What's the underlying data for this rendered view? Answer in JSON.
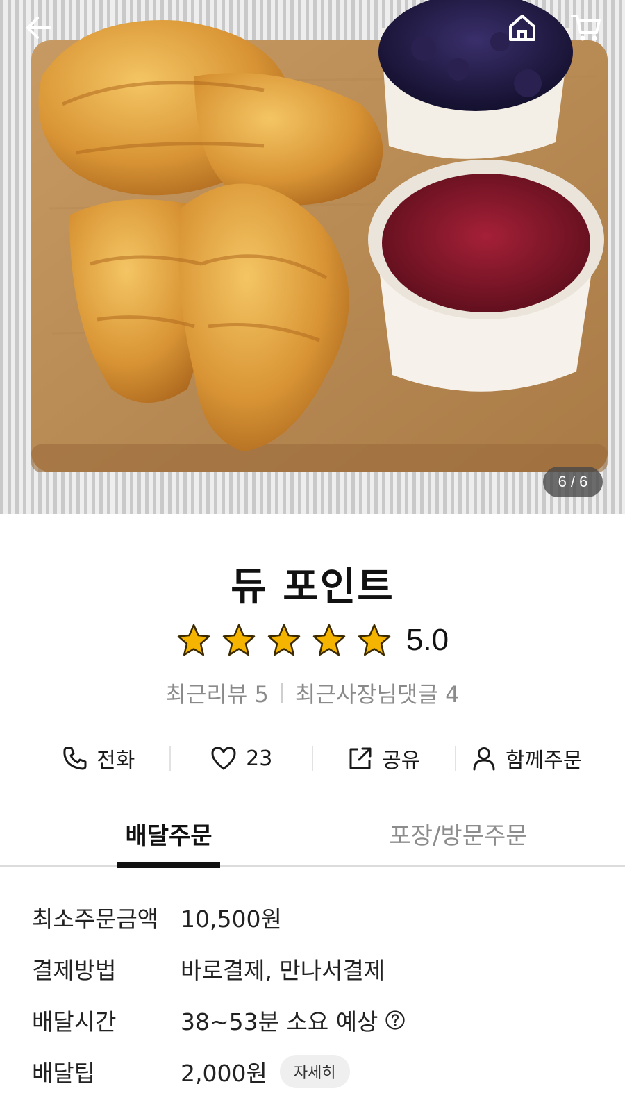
{
  "topbar": {
    "back_icon": "arrow-left-icon",
    "home_icon": "home-icon",
    "cart_icon": "cart-icon"
  },
  "gallery": {
    "indicator": "6 / 6",
    "current": 6,
    "total": 6
  },
  "store": {
    "name": "듀 포인트",
    "rating": "5.0",
    "star_count": 5,
    "star_color": "#f5b400",
    "reviews_label": "최근리뷰 5",
    "owner_replies_label": "최근사장님댓글 4"
  },
  "actions": [
    {
      "icon": "phone-icon",
      "label": "전화"
    },
    {
      "icon": "heart-icon",
      "label": "23"
    },
    {
      "icon": "share-icon",
      "label": "공유"
    },
    {
      "icon": "person-icon",
      "label": "함께주문"
    }
  ],
  "tabs": [
    {
      "label": "배달주문",
      "active": true
    },
    {
      "label": "포장/방문주문",
      "active": false
    }
  ],
  "info": {
    "min_order_label": "최소주문금액",
    "min_order_value": "10,500원",
    "payment_label": "결제방법",
    "payment_value": "바로결제, 만나서결제",
    "time_label": "배달시간",
    "time_value": "38~53분 소요 예상",
    "tip_label": "배달팁",
    "tip_value": "2,000원",
    "tip_detail_button": "자세히"
  }
}
